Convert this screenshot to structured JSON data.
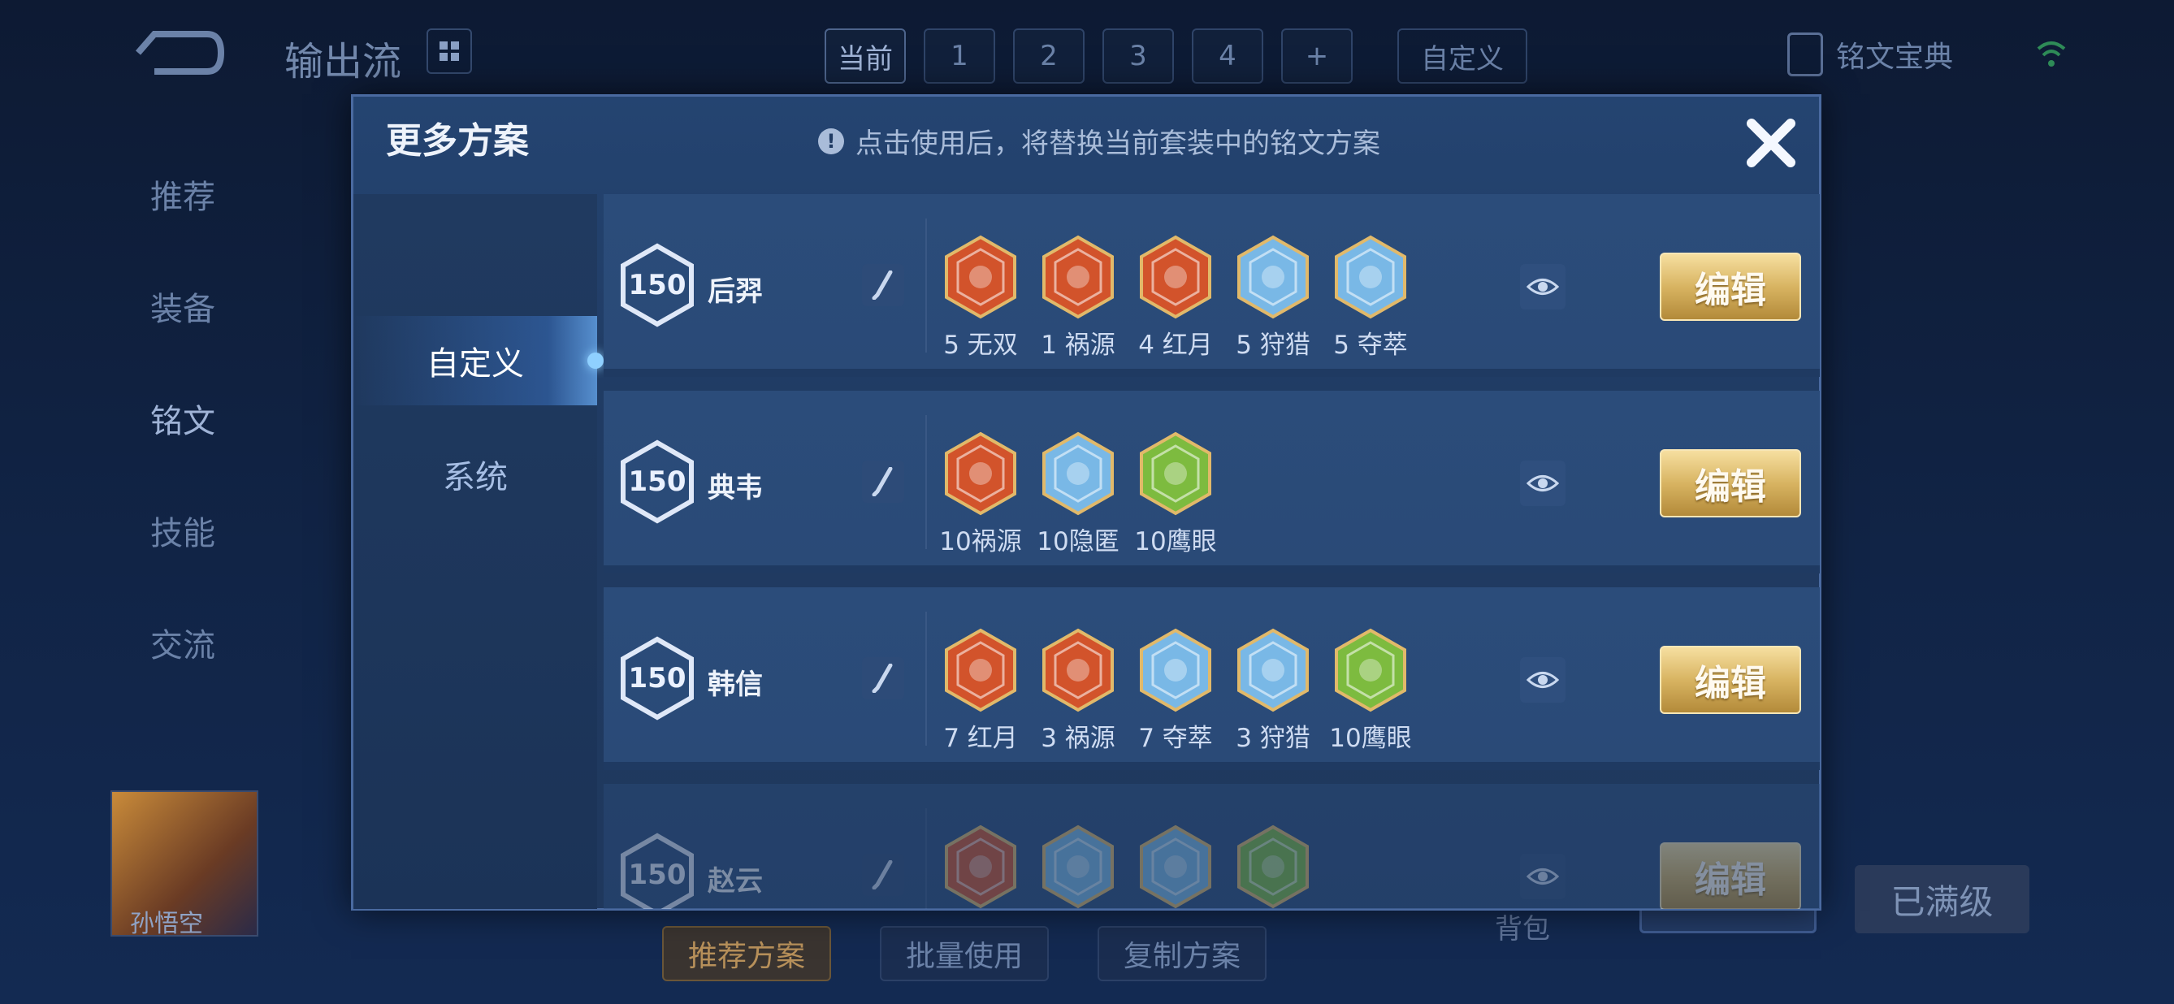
{
  "top": {
    "title": "输出流",
    "tabs": [
      "当前",
      "1",
      "2",
      "3",
      "4",
      "+"
    ],
    "custom": "自定义",
    "book": "铭文宝典"
  },
  "sidenav": [
    "推荐",
    "装备",
    "铭文",
    "技能",
    "交流"
  ],
  "avatar_name": "孙悟空",
  "bottom": {
    "recommend": "推荐方案",
    "batch": "批量使用",
    "copy": "复制方案",
    "bag": "背包",
    "maxed": "已满级"
  },
  "modal": {
    "title": "更多方案",
    "hint": "点击使用后，将替换当前套装中的铭文方案",
    "tabs": [
      "自定义",
      "系统"
    ],
    "edit_label": "编辑",
    "plans": [
      {
        "level": "150",
        "hero": "后羿",
        "runes": [
          {
            "label": "5 无双",
            "color": "red"
          },
          {
            "label": "1 祸源",
            "color": "red"
          },
          {
            "label": "4 红月",
            "color": "red"
          },
          {
            "label": "5 狩猎",
            "color": "blue"
          },
          {
            "label": "5 夺萃",
            "color": "blue"
          }
        ]
      },
      {
        "level": "150",
        "hero": "典韦",
        "runes": [
          {
            "label": "10祸源",
            "color": "red"
          },
          {
            "label": "10隐匿",
            "color": "blue"
          },
          {
            "label": "10鹰眼",
            "color": "green"
          }
        ]
      },
      {
        "level": "150",
        "hero": "韩信",
        "runes": [
          {
            "label": "7 红月",
            "color": "red"
          },
          {
            "label": "3 祸源",
            "color": "red"
          },
          {
            "label": "7 夺萃",
            "color": "blue"
          },
          {
            "label": "3 狩猎",
            "color": "blue"
          },
          {
            "label": "10鹰眼",
            "color": "green"
          }
        ]
      },
      {
        "level": "150",
        "hero": "赵云",
        "runes": [
          {
            "label": "",
            "color": "red"
          },
          {
            "label": "",
            "color": "blue"
          },
          {
            "label": "",
            "color": "blue"
          },
          {
            "label": "",
            "color": "green"
          }
        ]
      }
    ]
  },
  "colors": {
    "red": "#d2532b",
    "blue": "#79b8e6",
    "green": "#7dbb3f",
    "gold": "#d8b462"
  }
}
